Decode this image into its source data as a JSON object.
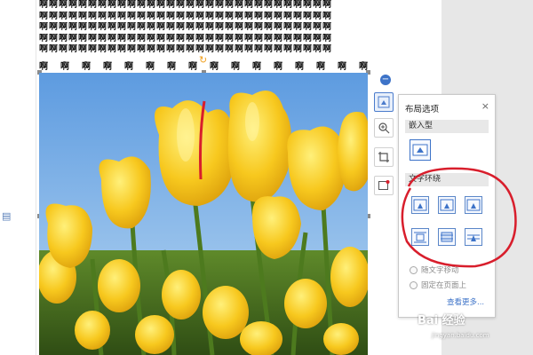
{
  "document": {
    "text_lines": [
      "啊啊啊啊啊啊啊啊啊啊啊啊啊啊啊啊啊啊啊啊啊啊啊啊啊啊啊啊啊啊",
      "啊啊啊啊啊啊啊啊啊啊啊啊啊啊啊啊啊啊啊啊啊啊啊啊啊啊啊啊啊啊",
      "啊啊啊啊啊啊啊啊啊啊啊啊啊啊啊啊啊啊啊啊啊啊啊啊啊啊啊啊啊啊",
      "啊啊啊啊啊啊啊啊啊啊啊啊啊啊啊啊啊啊啊啊啊啊啊啊啊啊啊啊啊啊",
      "啊啊啊啊啊啊啊啊啊啊啊啊啊啊啊啊啊啊啊啊啊啊啊啊啊啊啊啊啊啊"
    ],
    "sparse_chars": [
      "啊",
      "啊",
      "啊",
      "啊",
      "啊",
      "啊",
      "啊",
      "啊",
      "啊",
      "啊",
      "啊",
      "啊",
      "啊",
      "啊",
      "啊",
      "啊"
    ],
    "image_icon": "tulip-photo"
  },
  "toolbar": {
    "collapse_icon": "minus-circle-icon",
    "buttons": [
      {
        "name": "layout-options-icon",
        "active": true
      },
      {
        "name": "zoom-in-icon",
        "active": false
      },
      {
        "name": "crop-icon",
        "active": false
      },
      {
        "name": "border-icon",
        "active": false
      }
    ]
  },
  "panel": {
    "title": "布局选项",
    "close": "×",
    "inline_header": "嵌入型",
    "wrap_header": "文字环绕",
    "radio_move_with_text": "随文字移动",
    "radio_fixed_on_page": "固定在页面上",
    "more_link": "查看更多..."
  },
  "watermark": {
    "text": "Bai 经验",
    "url": "jingyan.baidu.com"
  },
  "colors": {
    "accent": "#3d73c8",
    "annotation_red": "#d81e2c",
    "sky": "#5d9be0",
    "tulip_yellow": "#f2bf1c"
  }
}
